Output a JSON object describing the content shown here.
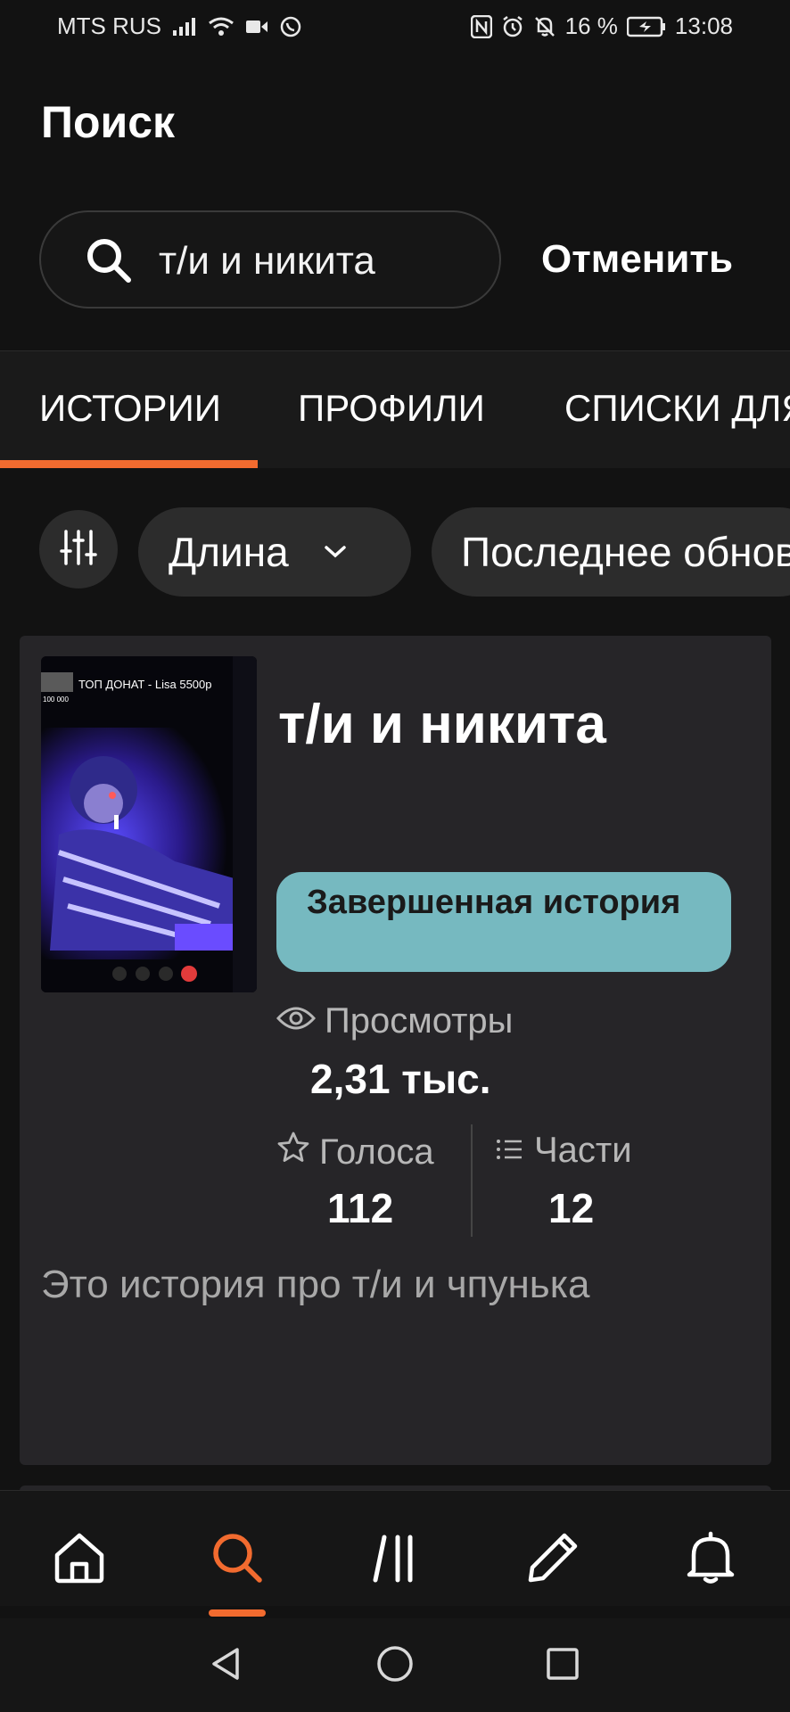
{
  "status_bar": {
    "carrier": "MTS RUS",
    "battery_percent": "16 %",
    "time": "13:08",
    "icons": [
      "signal-icon",
      "wifi-icon",
      "video-icon",
      "whatsapp-icon",
      "nfc-icon",
      "alarm-icon",
      "mute-icon",
      "battery-icon"
    ]
  },
  "header": {
    "title": "Поиск",
    "search": {
      "value": "т/и и никита",
      "icon": "search-icon"
    },
    "cancel_label": "Отменить"
  },
  "tabs": [
    {
      "label": "ИСТОРИИ",
      "active": true
    },
    {
      "label": "ПРОФИЛИ",
      "active": false
    },
    {
      "label": "СПИСКИ ДЛЯ ЧТЕНИЯ",
      "active": false
    }
  ],
  "filters": {
    "settings_icon": "sliders-icon",
    "length_label": "Длина",
    "updated_label": "Последнее обновление"
  },
  "story": {
    "title": "т/и и никита",
    "status": "Завершенная история",
    "views_label": "Просмотры",
    "views_value": "2,31 тыс.",
    "votes_label": "Голоса",
    "votes_value": "112",
    "parts_label": "Части",
    "parts_value": "12",
    "description": "Это история про т/и и чпунька",
    "cover": {
      "caption": "ТОП ДОНАТ - Lisa 5500р",
      "counter": "100 000"
    }
  },
  "bottom_nav": {
    "items": [
      "home-icon",
      "search-icon",
      "library-icon",
      "write-icon",
      "bell-icon"
    ],
    "active": "search-icon"
  },
  "colors": {
    "background": "#121212",
    "accent": "#f26b2f",
    "card": "#262528",
    "badge": "#76b9c0",
    "chip": "#2c2c2c"
  }
}
